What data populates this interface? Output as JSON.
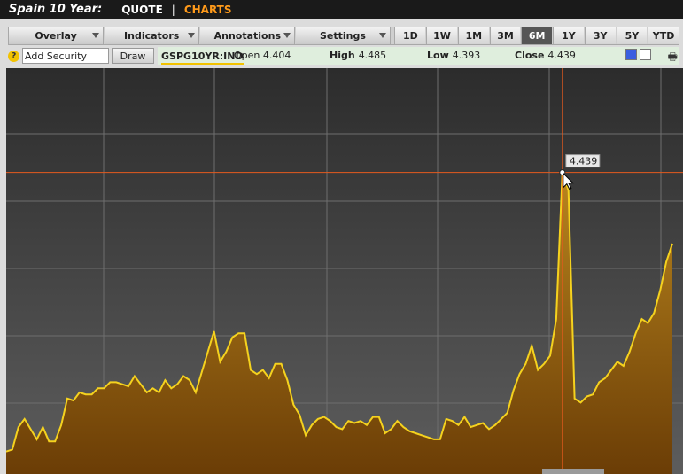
{
  "header": {
    "title": "Spain 10 Year:",
    "nav_quote": "QUOTE",
    "nav_charts": "CHARTS"
  },
  "toolbar": {
    "menus": [
      "Overlay",
      "Indicators",
      "Annotations",
      "Settings"
    ],
    "ranges": [
      "1D",
      "1W",
      "1M",
      "3M",
      "6M",
      "1Y",
      "3Y",
      "5Y",
      "YTD"
    ],
    "active_range": "6M"
  },
  "infobar": {
    "help_label": "?",
    "add_security_value": "Add Security",
    "draw_label": "Draw",
    "symbol": "GSPG10YR:IND",
    "open_label": "Open",
    "open_value": "4.404",
    "high_label": "High",
    "high_value": "4.485",
    "low_label": "Low",
    "low_value": "4.393",
    "close_label": "Close",
    "close_value": "4.439"
  },
  "colors": {
    "line": "#f5d21e",
    "fill_top": "#b9861e",
    "fill_bottom": "#6b3d06",
    "crosshair": "#e55a1e",
    "background_top": "#2c2c2c",
    "background_bottom": "#5d5d5d"
  },
  "chart_data": {
    "type": "area",
    "tooltip_value": "4.439",
    "x": [
      1,
      2,
      3,
      4,
      5,
      6,
      7,
      8,
      9,
      10,
      11,
      12,
      13,
      14,
      15,
      16,
      17,
      18,
      19,
      20,
      21,
      22,
      23,
      24,
      25,
      26,
      27,
      28,
      29,
      30,
      31,
      32,
      33,
      34,
      35,
      36,
      37,
      38,
      39,
      40,
      41,
      42,
      43,
      44,
      45,
      46,
      47,
      48,
      49,
      50,
      51,
      52,
      53,
      54,
      55,
      56,
      57,
      58,
      59,
      60,
      61,
      62,
      63,
      64,
      65,
      66,
      67,
      68,
      69,
      70,
      71,
      72,
      73,
      74,
      75,
      76,
      77,
      78,
      79,
      80,
      81,
      82,
      83,
      84,
      85,
      86,
      87,
      88,
      89,
      90,
      91,
      92,
      93,
      94,
      95,
      96,
      97,
      98,
      99,
      100,
      101,
      102,
      103,
      104,
      105,
      106,
      107,
      108,
      109,
      110,
      111,
      112,
      113,
      114,
      115,
      116,
      117,
      118,
      119,
      120
    ],
    "values": [
      3.07,
      3.08,
      3.19,
      3.23,
      3.18,
      3.13,
      3.19,
      3.12,
      3.12,
      3.2,
      3.33,
      3.32,
      3.36,
      3.35,
      3.35,
      3.38,
      3.38,
      3.41,
      3.41,
      3.4,
      3.39,
      3.44,
      3.4,
      3.36,
      3.38,
      3.36,
      3.42,
      3.38,
      3.4,
      3.44,
      3.42,
      3.36,
      3.46,
      3.56,
      3.66,
      3.51,
      3.56,
      3.63,
      3.65,
      3.65,
      3.47,
      3.45,
      3.47,
      3.43,
      3.5,
      3.5,
      3.42,
      3.3,
      3.25,
      3.15,
      3.2,
      3.23,
      3.24,
      3.22,
      3.19,
      3.18,
      3.22,
      3.21,
      3.22,
      3.2,
      3.24,
      3.24,
      3.16,
      3.18,
      3.22,
      3.19,
      3.17,
      3.16,
      3.15,
      3.14,
      3.13,
      3.13,
      3.23,
      3.22,
      3.2,
      3.24,
      3.19,
      3.2,
      3.21,
      3.18,
      3.2,
      3.23,
      3.26,
      3.37,
      3.45,
      3.5,
      3.59,
      3.47,
      3.5,
      3.54,
      3.72,
      4.44,
      4.35,
      3.33,
      3.31,
      3.34,
      3.35,
      3.41,
      3.43,
      3.47,
      3.51,
      3.49,
      3.56,
      3.65,
      3.72,
      3.7,
      3.75,
      3.86,
      4.0,
      4.09
    ],
    "crosshair_value": 4.439,
    "crosshair_x": 92,
    "ylim": [
      2.96,
      4.95
    ],
    "grid": true,
    "title": "",
    "xlabel": "",
    "ylabel": ""
  }
}
